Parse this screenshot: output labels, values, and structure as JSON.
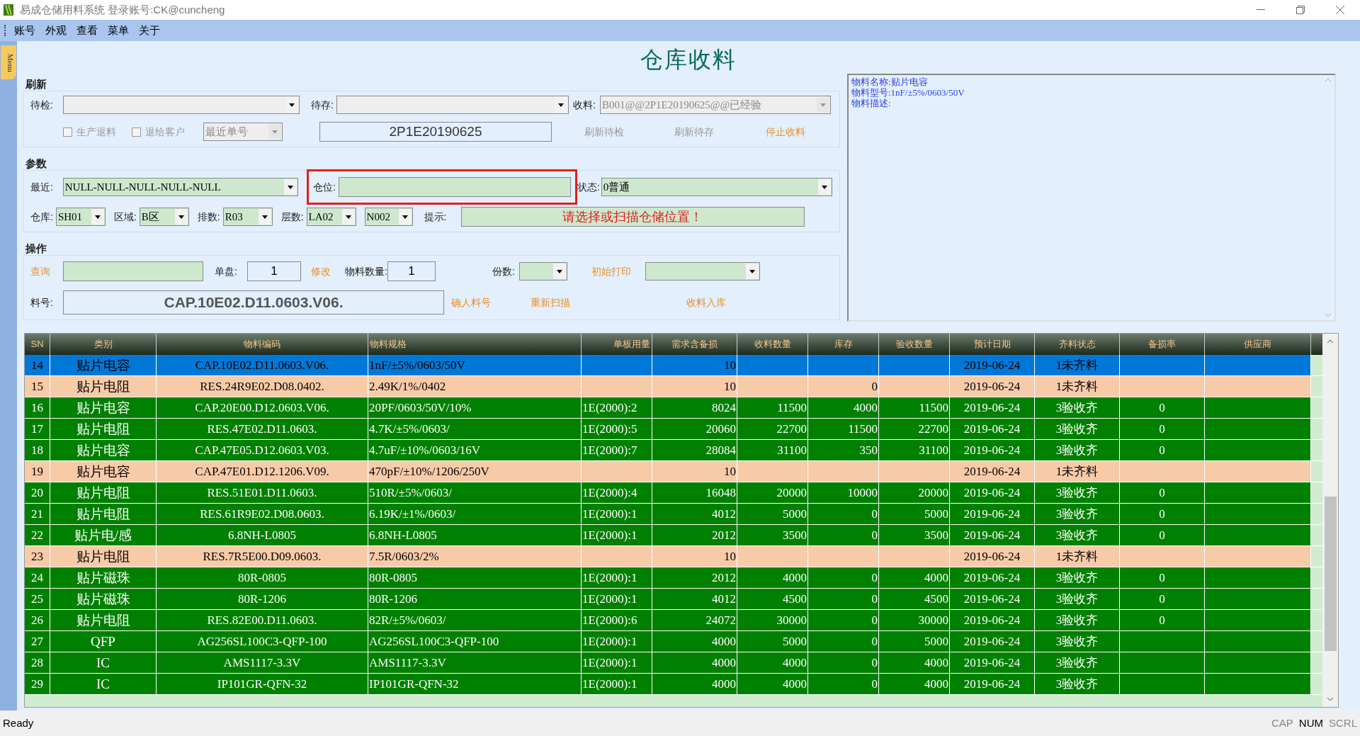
{
  "window": {
    "title": "易成仓储用料系统 登录账号:CK@cuncheng"
  },
  "menu": [
    "账号",
    "外观",
    "查看",
    "菜单",
    "关于"
  ],
  "side_tab": "Menu",
  "page_title": "仓库收料",
  "refresh": {
    "title": "刷新",
    "pending_check": {
      "label": "待检:"
    },
    "pending_store": {
      "label": "待存:"
    },
    "receive": {
      "label": "收料:",
      "value": "B001@@2P1E20190625@@已经验"
    },
    "checkboxes": [
      {
        "label": "生产退料",
        "checked": false
      },
      {
        "label": "退给客户",
        "checked": false
      }
    ],
    "recent_order": {
      "value": "最近单号"
    },
    "order_no": "2P1E20190625",
    "links": [
      {
        "label": "刷新待检",
        "disabled": true
      },
      {
        "label": "刷新待存",
        "disabled": true
      },
      {
        "label": "停止收料",
        "disabled": false
      }
    ]
  },
  "params": {
    "title": "参数",
    "recent": {
      "label": "最近:",
      "value": "NULL-NULL-NULL-NULL-NULL"
    },
    "location": {
      "label": "仓位:",
      "highlighted": true
    },
    "state": {
      "label": "状态:",
      "value": "0普通"
    },
    "selects": [
      {
        "label": "仓库:",
        "value": "SH01"
      },
      {
        "label": "区域:",
        "value": "B区"
      },
      {
        "label": "排数:",
        "value": "R03"
      },
      {
        "label": "层数:",
        "value": "LA02"
      },
      {
        "value": "N002"
      }
    ],
    "hint": {
      "label": "提示:",
      "value": "请选择或扫描仓储位置！"
    }
  },
  "ops": {
    "title": "操作",
    "query": {
      "label": "查询"
    },
    "single": {
      "label": "单盘:",
      "value": "1"
    },
    "modify": "修改",
    "qty": {
      "label": "物料数量:",
      "value": "1"
    },
    "copies": {
      "label": "份数:"
    },
    "print": {
      "label": "初始打印"
    },
    "part": {
      "label": "料号:",
      "value": "CAP.10E02.D11.0603.V06."
    },
    "links": [
      "确人料号",
      "重新扫描",
      "收料入库"
    ]
  },
  "info": [
    "物料名称:贴片电容",
    "物料型号:1nF/±5%/0603/50V",
    "物料描述:"
  ],
  "table": {
    "columns": [
      "SN",
      "类别",
      "物料编码",
      "物料规格",
      "单板用量",
      "需求含备损",
      "收料数量",
      "库存",
      "验收数量",
      "预计日期",
      "齐料状态",
      "备损率",
      "供应商"
    ],
    "rows": [
      {
        "kind": "pending",
        "selected": true,
        "cells": [
          "14",
          "贴片电容",
          "CAP.10E02.D11.0603.V06.",
          "1nF/±5%/0603/50V",
          "",
          "10",
          "",
          "",
          "",
          "2019-06-24",
          "1未齐料",
          "",
          ""
        ]
      },
      {
        "kind": "pending",
        "selected": false,
        "cells": [
          "15",
          "贴片电阻",
          "RES.24R9E02.D08.0402.",
          "2.49K/1%/0402",
          "",
          "10",
          "",
          "0",
          "",
          "2019-06-24",
          "1未齐料",
          "",
          ""
        ]
      },
      {
        "kind": "complete",
        "selected": false,
        "cells": [
          "16",
          "贴片电容",
          "CAP.20E00.D12.0603.V06.",
          "20PF/0603/50V/10%",
          "1E(2000):2",
          "8024",
          "11500",
          "4000",
          "11500",
          "2019-06-24",
          "3验收齐",
          "0",
          ""
        ]
      },
      {
        "kind": "complete",
        "selected": false,
        "cells": [
          "17",
          "贴片电阻",
          "RES.47E02.D11.0603.",
          "4.7K/±5%/0603/",
          "1E(2000):5",
          "20060",
          "22700",
          "11500",
          "22700",
          "2019-06-24",
          "3验收齐",
          "0",
          ""
        ]
      },
      {
        "kind": "complete",
        "selected": false,
        "cells": [
          "18",
          "贴片电容",
          "CAP.47E05.D12.0603.V03.",
          "4.7uF/±10%/0603/16V",
          "1E(2000):7",
          "28084",
          "31100",
          "350",
          "31100",
          "2019-06-24",
          "3验收齐",
          "0",
          ""
        ]
      },
      {
        "kind": "pending",
        "selected": false,
        "cells": [
          "19",
          "贴片电容",
          "CAP.47E01.D12.1206.V09.",
          "470pF/±10%/1206/250V",
          "",
          "10",
          "",
          "",
          "",
          "2019-06-24",
          "1未齐料",
          "",
          ""
        ]
      },
      {
        "kind": "complete",
        "selected": false,
        "cells": [
          "20",
          "贴片电阻",
          "RES.51E01.D11.0603.",
          "510R/±5%/0603/",
          "1E(2000):4",
          "16048",
          "20000",
          "10000",
          "20000",
          "2019-06-24",
          "3验收齐",
          "0",
          ""
        ]
      },
      {
        "kind": "complete",
        "selected": false,
        "cells": [
          "21",
          "贴片电阻",
          "RES.61R9E02.D08.0603.",
          "6.19K/±1%/0603/",
          "1E(2000):1",
          "4012",
          "5000",
          "0",
          "5000",
          "2019-06-24",
          "3验收齐",
          "0",
          ""
        ]
      },
      {
        "kind": "complete",
        "selected": false,
        "cells": [
          "22",
          "贴片电/感",
          "6.8NH-L0805",
          "6.8NH-L0805",
          "1E(2000):1",
          "2012",
          "3500",
          "0",
          "3500",
          "2019-06-24",
          "3验收齐",
          "0",
          ""
        ]
      },
      {
        "kind": "pending",
        "selected": false,
        "cells": [
          "23",
          "贴片电阻",
          "RES.7R5E00.D09.0603.",
          "7.5R/0603/2%",
          "",
          "10",
          "",
          "",
          "",
          "2019-06-24",
          "1未齐料",
          "",
          ""
        ]
      },
      {
        "kind": "complete",
        "selected": false,
        "cells": [
          "24",
          "贴片磁珠",
          "80R-0805",
          "80R-0805",
          "1E(2000):1",
          "2012",
          "4000",
          "0",
          "4000",
          "2019-06-24",
          "3验收齐",
          "0",
          ""
        ]
      },
      {
        "kind": "complete",
        "selected": false,
        "cells": [
          "25",
          "贴片磁珠",
          "80R-1206",
          "80R-1206",
          "1E(2000):1",
          "4012",
          "4500",
          "0",
          "4500",
          "2019-06-24",
          "3验收齐",
          "0",
          ""
        ]
      },
      {
        "kind": "complete",
        "selected": false,
        "cells": [
          "26",
          "贴片电阻",
          "RES.82E00.D11.0603.",
          "82R/±5%/0603/",
          "1E(2000):6",
          "24072",
          "30000",
          "0",
          "30000",
          "2019-06-24",
          "3验收齐",
          "0",
          ""
        ]
      },
      {
        "kind": "complete",
        "selected": false,
        "cells": [
          "27",
          "QFP",
          "AG256SL100C3-QFP-100",
          "AG256SL100C3-QFP-100",
          "1E(2000):1",
          "4000",
          "5000",
          "0",
          "5000",
          "2019-06-24",
          "3验收齐",
          "",
          ""
        ]
      },
      {
        "kind": "complete",
        "selected": false,
        "cells": [
          "28",
          "IC",
          "AMS1117-3.3V",
          "AMS1117-3.3V",
          "1E(2000):1",
          "4000",
          "4000",
          "0",
          "4000",
          "2019-06-24",
          "3验收齐",
          "",
          ""
        ]
      },
      {
        "kind": "complete",
        "selected": false,
        "cells": [
          "29",
          "IC",
          "IP101GR-QFN-32",
          "IP101GR-QFN-32",
          "1E(2000):1",
          "4000",
          "4000",
          "0",
          "4000",
          "2019-06-24",
          "3验收齐",
          "",
          ""
        ]
      }
    ]
  },
  "status_bar": {
    "text": "Ready",
    "indicators": [
      {
        "label": "CAP",
        "on": false
      },
      {
        "label": "NUM",
        "on": true
      },
      {
        "label": "SCRL",
        "on": false
      }
    ]
  }
}
